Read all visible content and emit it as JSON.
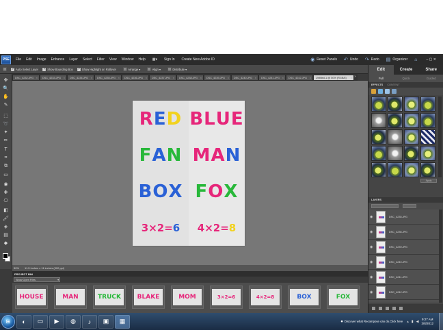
{
  "menubar": {
    "logo": "PSE",
    "items": [
      "File",
      "Edit",
      "Image",
      "Enhance",
      "Layer",
      "Select",
      "Filter",
      "View",
      "Window",
      "Help"
    ],
    "sign_in": "Sign In",
    "create_id": "Create New Adobe ID",
    "reset_panels": "Reset Panels",
    "undo": "Undo",
    "redo": "Redo",
    "organizer": "Organizer"
  },
  "options": {
    "auto_select": "Auto Select Layer",
    "bounding_box": "Show Bounding Box",
    "highlight": "Show Highlight on Rollover",
    "arrange": "Arrange",
    "align": "Align",
    "distribute": "Distribute"
  },
  "tabs": [
    "DSC_4232.JPG",
    "DSC_4233.JPG",
    "DSC_4234.JPG",
    "DSC_4235.JPG",
    "DSC_4236.JPG",
    "DSC_4237.JPG",
    "DSC_4238.JPG",
    "DSC_4239.JPG",
    "DSC_4240.JPG",
    "DSC_4241.JPG",
    "DSC_4242.JPG",
    "Untitled-1 @ 50% (RGB/8)"
  ],
  "canvas": {
    "cells": [
      {
        "letters": [
          "R",
          "E",
          "D"
        ],
        "colors": [
          "#e6267a",
          "#2a61d6",
          "#f2d21e"
        ]
      },
      {
        "letters": [
          "B",
          "L",
          "U",
          "E"
        ],
        "colors": [
          "#e6267a",
          "#e6267a",
          "#e6267a",
          "#e6267a"
        ]
      },
      {
        "letters": [
          "F",
          "A",
          "N"
        ],
        "colors": [
          "#28b83a",
          "#2a61d6",
          "#28b83a"
        ]
      },
      {
        "letters": [
          "M",
          "A",
          "N"
        ],
        "colors": [
          "#e6267a",
          "#e6267a",
          "#2a61d6"
        ]
      },
      {
        "letters": [
          "B",
          "O",
          "X"
        ],
        "colors": [
          "#2a61d6",
          "#2a61d6",
          "#2a61d6"
        ]
      },
      {
        "letters": [
          "F",
          "O",
          "X"
        ],
        "colors": [
          "#28b83a",
          "#e6267a",
          "#28b83a"
        ]
      },
      {
        "letters": [
          "3",
          "×",
          "2",
          "=",
          "6"
        ],
        "colors": [
          "#e6267a",
          "#e6267a",
          "#e6267a",
          "#e6267a",
          "#2a61d6"
        ]
      },
      {
        "letters": [
          "4",
          "×",
          "2",
          "=",
          "8"
        ],
        "colors": [
          "#e6267a",
          "#e6267a",
          "#e6267a",
          "#e6267a",
          "#f2d21e"
        ]
      }
    ]
  },
  "status": {
    "zoom": "50%",
    "doc_size": "11.5 inches x 11 inches (300 ppi)"
  },
  "bin": {
    "title": "PROJECT BIN",
    "select": "Show Open Files",
    "thumbs": [
      {
        "text": "HOUSE",
        "color": "#e6267a"
      },
      {
        "text": "MAN",
        "color": "#e6267a"
      },
      {
        "text": "TRUCK",
        "color": "#28b83a"
      },
      {
        "text": "BLAKE",
        "color": "#e6267a"
      },
      {
        "text": "MOM",
        "color": "#e6267a"
      },
      {
        "text": "3×2=6",
        "color": "#e6267a"
      },
      {
        "text": "4×2=8",
        "color": "#e6267a"
      },
      {
        "text": "BOX",
        "color": "#2a61d6"
      },
      {
        "text": "FOX",
        "color": "#28b83a"
      }
    ]
  },
  "panel": {
    "modes": [
      "Edit",
      "Create",
      "Share"
    ],
    "subtabs": [
      "Full",
      "Quick",
      "Guided"
    ],
    "effects_title": "EFFECTS",
    "content_title": "CONTENT",
    "apply": "Apply",
    "layers_title": "LAYERS",
    "layers": [
      "DSC_4235.JPG",
      "DSC_4236.JPG",
      "DSC_4239.JPG",
      "DSC_4240.JPG",
      "DSC_4241.JPG",
      "DSC_4242.JPG"
    ]
  },
  "taskbar": {
    "notification": "Discover what Recompose can do.Click here",
    "time": "9:27 AM",
    "date": "3/8/2012"
  }
}
